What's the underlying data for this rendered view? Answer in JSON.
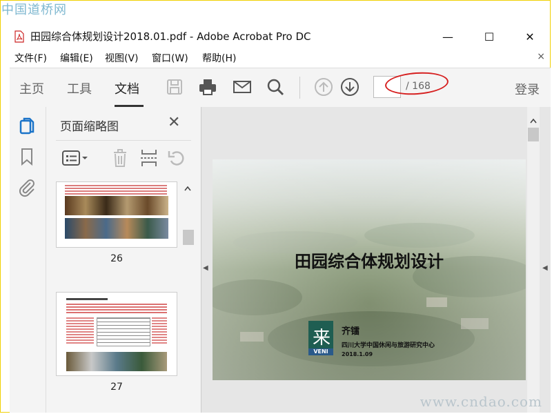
{
  "watermark_top": "中国道桥网",
  "watermark_bottom": "www.cndao.com",
  "window": {
    "title": "田园综合体规划设计2018.01.pdf - Adobe Acrobat Pro DC",
    "minimize": "—",
    "maximize": "☐",
    "close": "✕"
  },
  "menu": {
    "items": [
      "文件(F)",
      "编辑(E)",
      "视图(V)",
      "窗口(W)",
      "帮助(H)"
    ],
    "close": "×"
  },
  "toolbar": {
    "tabs": [
      "主页",
      "工具",
      "文档"
    ],
    "active_tab": "文档",
    "icons": [
      "save-icon",
      "print-icon",
      "email-icon",
      "search-icon",
      "previous-page-icon",
      "next-page-icon"
    ],
    "page_current": "",
    "page_total": "/ 168",
    "login": "登录"
  },
  "left_strip": {
    "icons": [
      "page-thumbnails-icon",
      "bookmark-icon",
      "attachment-icon"
    ]
  },
  "panel": {
    "title": "页面缩略图",
    "close": "✕",
    "tools": [
      "options-icon",
      "delete-icon",
      "insert-pages-icon",
      "rotate-icon"
    ],
    "thumbnails": [
      {
        "label": "26"
      },
      {
        "label": "27"
      }
    ]
  },
  "document": {
    "slide_title": "田园综合体规划设计",
    "author": "齐镭",
    "organization": "四川大学中国休闲与旅游研究中心",
    "date": "2018.1.09",
    "logo_band": "VENI"
  },
  "colors": {
    "annotation_circle": "#d62020",
    "frame_border": "#f0d000",
    "logo_green": "#1f5e52"
  }
}
